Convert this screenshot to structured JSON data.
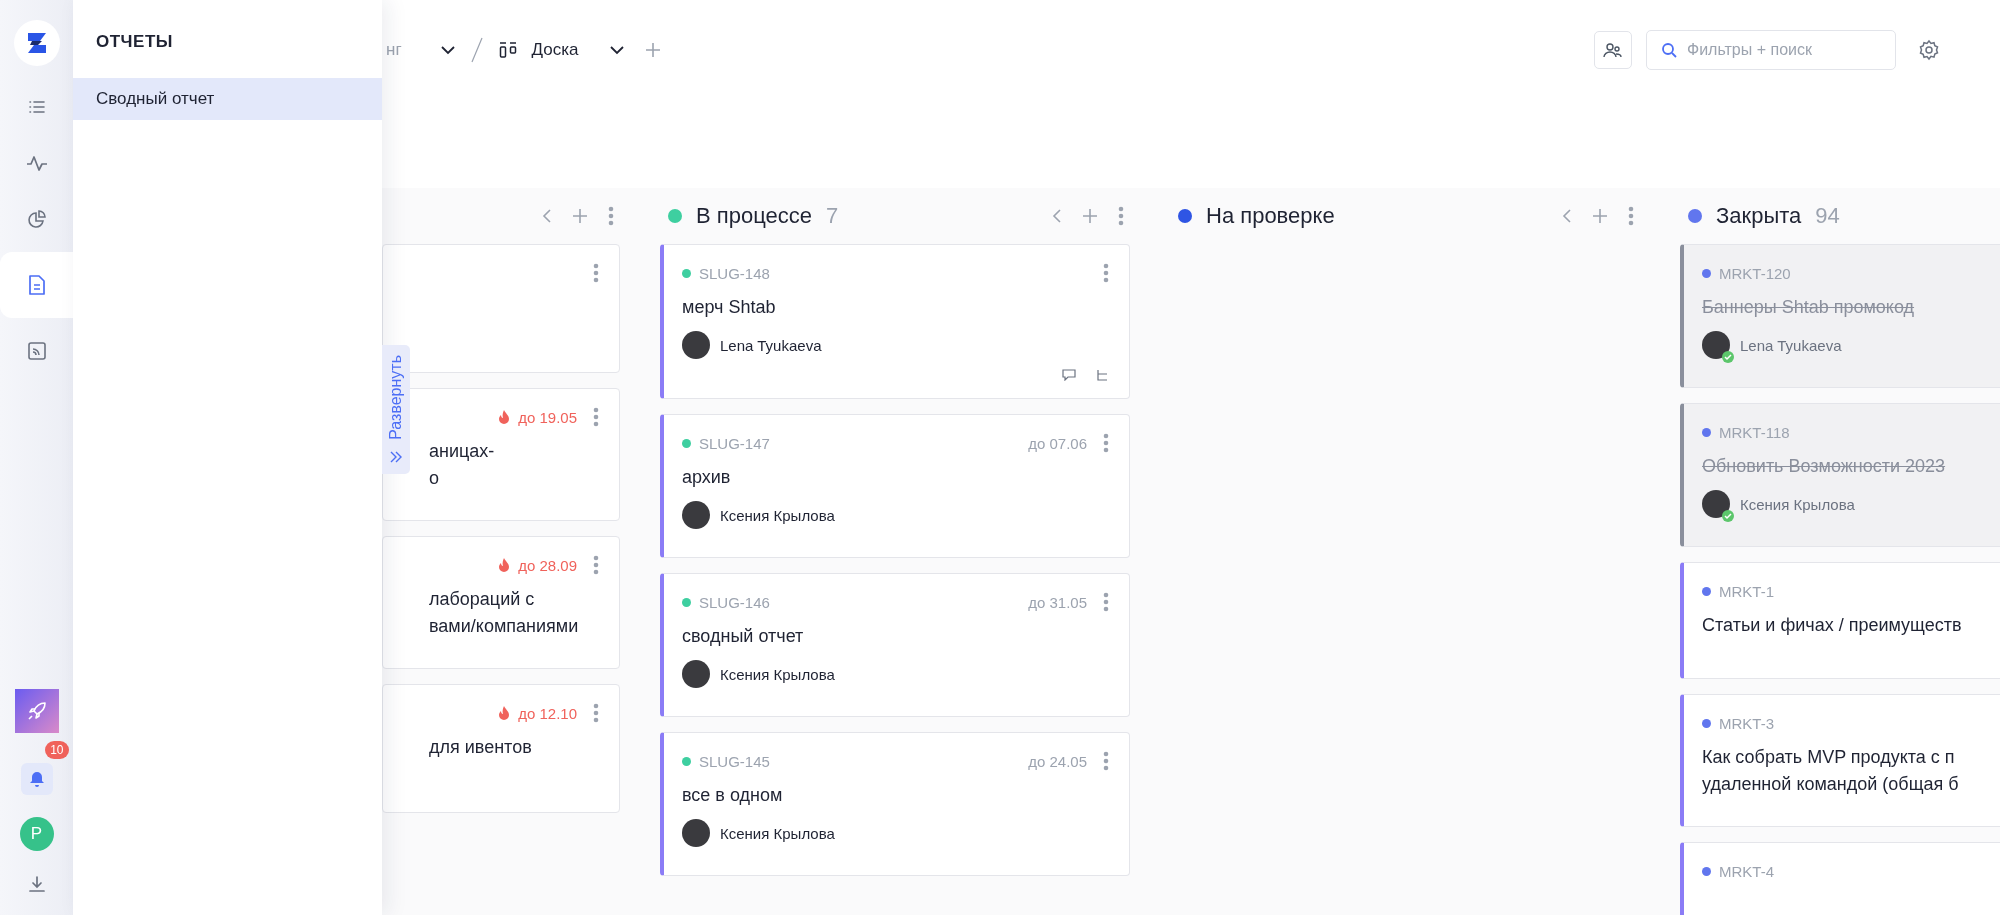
{
  "sidebar": {
    "items": [
      {
        "kind": "list",
        "selected": false
      },
      {
        "kind": "activity",
        "selected": false
      },
      {
        "kind": "pie",
        "selected": false
      },
      {
        "kind": "report",
        "selected": true
      },
      {
        "kind": "feed",
        "selected": false
      }
    ],
    "notifications": {
      "badge": "10"
    },
    "user": {
      "initial": "P"
    }
  },
  "reports_panel": {
    "title": "ОТЧЕТЫ",
    "items": [
      {
        "label": "Сводный отчет",
        "selected": true
      }
    ]
  },
  "breadcrumb": {
    "project": "нг",
    "view": "Доска"
  },
  "search": {
    "placeholder": "Фильтры + поиск"
  },
  "expand_tab": {
    "label": "Развернуть"
  },
  "columns": [
    {
      "cards": [
        {
          "menu": true
        },
        {
          "due": "до 19.05",
          "urgent": true,
          "title_lines": [
            "аницах-",
            "о"
          ],
          "menu": true
        },
        {
          "due": "до 28.09",
          "urgent": true,
          "title_lines": [
            "лабораций с",
            "вами/компаниями"
          ],
          "menu": true
        },
        {
          "due": "до 12.10",
          "urgent": true,
          "title_lines": [
            "для ивентов"
          ],
          "menu": true
        }
      ]
    },
    {
      "title": "В процессе",
      "count": "7",
      "color": "#3ecfa0",
      "cards": [
        {
          "id": "SLUG-148",
          "title_lines": [
            "мерч Shtab"
          ],
          "assignee": "Lena Tyukaeva",
          "footer_icons": true,
          "done": false,
          "menu": true
        },
        {
          "id": "SLUG-147",
          "due": "до 07.06",
          "urgent": false,
          "title_lines": [
            "архив"
          ],
          "assignee": "Ксения Крылова",
          "done": false,
          "menu": true
        },
        {
          "id": "SLUG-146",
          "due": "до 31.05",
          "urgent": false,
          "title_lines": [
            "сводный отчет"
          ],
          "assignee": "Ксения Крылова",
          "done": false,
          "menu": true
        },
        {
          "id": "SLUG-145",
          "due": "до 24.05",
          "urgent": false,
          "title_lines": [
            "все в одном"
          ],
          "assignee": "Ксения Крылова",
          "done": false,
          "menu": true
        }
      ]
    },
    {
      "title": "На проверке",
      "color": "#2f55e4"
    },
    {
      "title": "Закрыта",
      "count": "94",
      "color": "#6176ee",
      "cards": [
        {
          "id": "MRKT-120",
          "title_lines": [
            "Баннеры Shtab промокод"
          ],
          "assignee": "Lena Tyukaeva",
          "done": true
        },
        {
          "id": "MRKT-118",
          "title_lines": [
            "Обновить Возможности 2023"
          ],
          "assignee": "Ксения Крылова",
          "done": true
        },
        {
          "id": "MRKT-1",
          "title_lines": [
            "Статьи и фичах / преимуществ"
          ],
          "done": false
        },
        {
          "id": "MRKT-3",
          "title_lines": [
            "Как собрать MVP продукта с п",
            "удаленной командой (общая б"
          ],
          "done": false
        },
        {
          "id": "MRKT-4",
          "done": false
        }
      ]
    }
  ]
}
